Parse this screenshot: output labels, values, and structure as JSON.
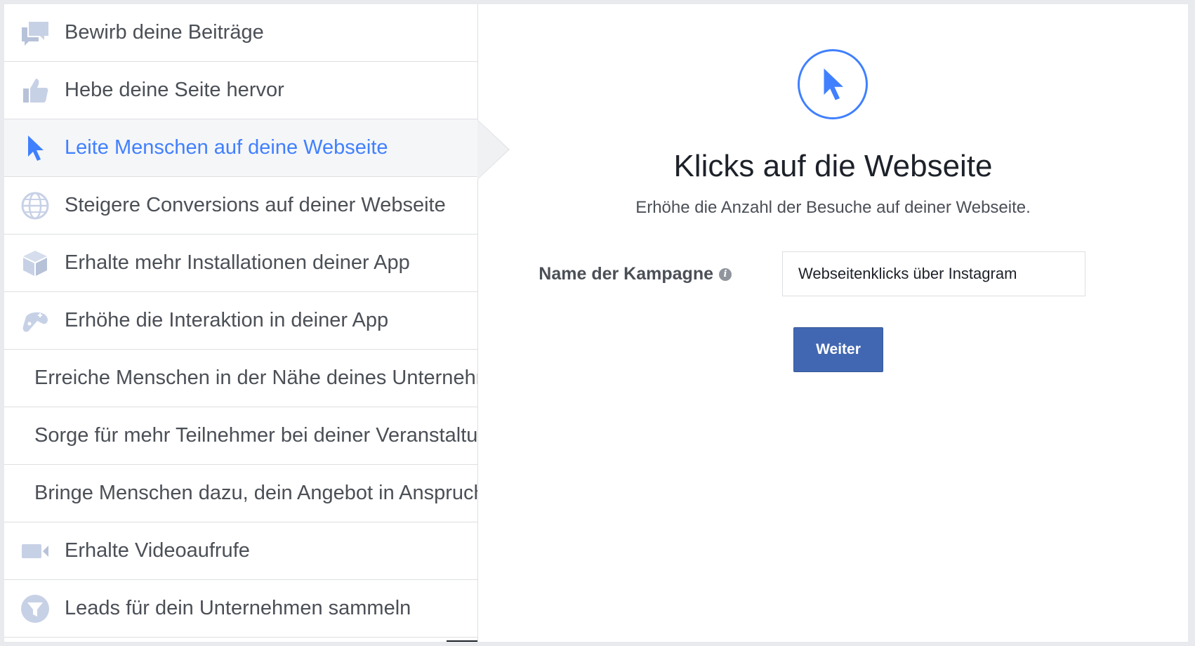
{
  "sidebar": {
    "items": [
      {
        "label": "Bewirb deine Beiträge",
        "icon": "speech-bubbles-icon"
      },
      {
        "label": "Hebe deine Seite hervor",
        "icon": "thumbs-up-icon"
      },
      {
        "label": "Leite Menschen auf deine Webseite",
        "icon": "cursor-icon",
        "selected": true
      },
      {
        "label": "Steigere Conversions auf deiner Webseite",
        "icon": "globe-icon"
      },
      {
        "label": "Erhalte mehr Installationen deiner App",
        "icon": "box-icon"
      },
      {
        "label": "Erhöhe die Interaktion in deiner App",
        "icon": "game-controller-icon"
      },
      {
        "label": "Erreiche Menschen in der Nähe deines Unternehmens"
      },
      {
        "label": "Sorge für mehr Teilnehmer bei deiner Veranstaltung"
      },
      {
        "label": "Bringe Menschen dazu, dein Angebot in Anspruch zu nehmen"
      },
      {
        "label": "Erhalte Videoaufrufe",
        "icon": "video-camera-icon"
      },
      {
        "label": "Leads für dein Unternehmen sammeln",
        "icon": "funnel-icon"
      }
    ]
  },
  "panel": {
    "icon": "cursor-icon",
    "title": "Klicks auf die Webseite",
    "subtitle": "Erhöhe die Anzahl der Besuche auf deiner Webseite.",
    "campaign_name_label": "Name der Kampagne",
    "campaign_name_value": "Webseitenklicks über Instagram",
    "continue_label": "Weiter"
  },
  "colors": {
    "accent": "#4080ff",
    "icon_gray": "#c7d1e6",
    "button": "#4267b2",
    "text": "#4b4f56"
  }
}
